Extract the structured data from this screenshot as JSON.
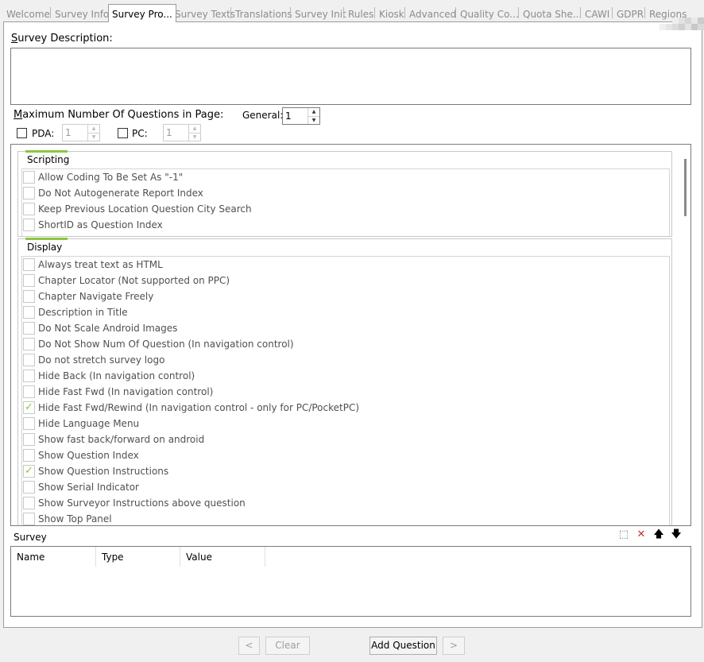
{
  "tabs": [
    {
      "label": "Welcome",
      "active": false
    },
    {
      "label": "Survey Info",
      "active": false
    },
    {
      "label": "Survey Pro...",
      "active": true
    },
    {
      "label": "Survey Texts",
      "active": false
    },
    {
      "label": "Translations",
      "active": false
    },
    {
      "label": "Survey Init",
      "active": false
    },
    {
      "label": "Rules",
      "active": false
    },
    {
      "label": "Kiosk",
      "active": false
    },
    {
      "label": "Advanced",
      "active": false
    },
    {
      "label": "Quality Co...",
      "active": false
    },
    {
      "label": "Quota She...",
      "active": false
    },
    {
      "label": "CAWI",
      "active": false
    },
    {
      "label": "GDPR",
      "active": false
    },
    {
      "label": "Regions",
      "active": false
    }
  ],
  "description": {
    "label_first": "S",
    "label_rest": "urvey Description:",
    "value": ""
  },
  "max_questions": {
    "label_first": "M",
    "label_rest": "aximum Number Of Questions in Page:",
    "general_label": "General:",
    "general_value": "1",
    "pda_label": "PDA:",
    "pda_value": "1",
    "pda_checked": false,
    "pc_label": "PC:",
    "pc_value": "1",
    "pc_checked": false
  },
  "groups": [
    {
      "title": "Scripting",
      "items": [
        {
          "label": "Allow Coding To Be Set As \"-1\"",
          "checked": false
        },
        {
          "label": "Do Not Autogenerate Report Index",
          "checked": false
        },
        {
          "label": "Keep Previous Location Question City Search",
          "checked": false
        },
        {
          "label": "ShortID as Question Index",
          "checked": false
        }
      ]
    },
    {
      "title": "Display",
      "items": [
        {
          "label": "Always treat text as HTML",
          "checked": false
        },
        {
          "label": "Chapter Locator (Not supported on PPC)",
          "checked": false
        },
        {
          "label": "Chapter Navigate Freely",
          "checked": false
        },
        {
          "label": "Description in Title",
          "checked": false
        },
        {
          "label": "Do Not Scale Android Images",
          "checked": false
        },
        {
          "label": "Do Not Show Num Of Question (In navigation control)",
          "checked": false
        },
        {
          "label": "Do not stretch survey logo",
          "checked": false
        },
        {
          "label": "Hide Back (In navigation control)",
          "checked": false
        },
        {
          "label": "Hide Fast Fwd (In navigation control)",
          "checked": false
        },
        {
          "label": "Hide Fast Fwd/Rewind (In navigation control - only for PC/PocketPC)",
          "checked": true
        },
        {
          "label": "Hide Language Menu",
          "checked": false
        },
        {
          "label": "Show fast back/forward on android",
          "checked": false
        },
        {
          "label": "Show Question Index",
          "checked": false
        },
        {
          "label": "Show Question Instructions",
          "checked": true
        },
        {
          "label": "Show Serial Indicator",
          "checked": false
        },
        {
          "label": "Show Surveyor Instructions above question",
          "checked": false
        },
        {
          "label": "Show Top Panel",
          "checked": false
        }
      ]
    }
  ],
  "survey_section": {
    "label": "Survey",
    "columns": [
      "Name",
      "Type",
      "Value"
    ],
    "tools": [
      {
        "icon": "new-item-icon",
        "glyph": "⬚"
      },
      {
        "icon": "delete-icon",
        "glyph": "✕"
      },
      {
        "icon": "arrow-up-icon",
        "glyph": "🡅"
      },
      {
        "icon": "arrow-down-icon",
        "glyph": "🡇"
      }
    ]
  },
  "bottom_buttons": {
    "prev": "<",
    "clear": "Clear",
    "add_question": "Add Question",
    "next": ">"
  },
  "colors": {
    "accent": "#8cc63f",
    "delete": "#c0392b"
  }
}
